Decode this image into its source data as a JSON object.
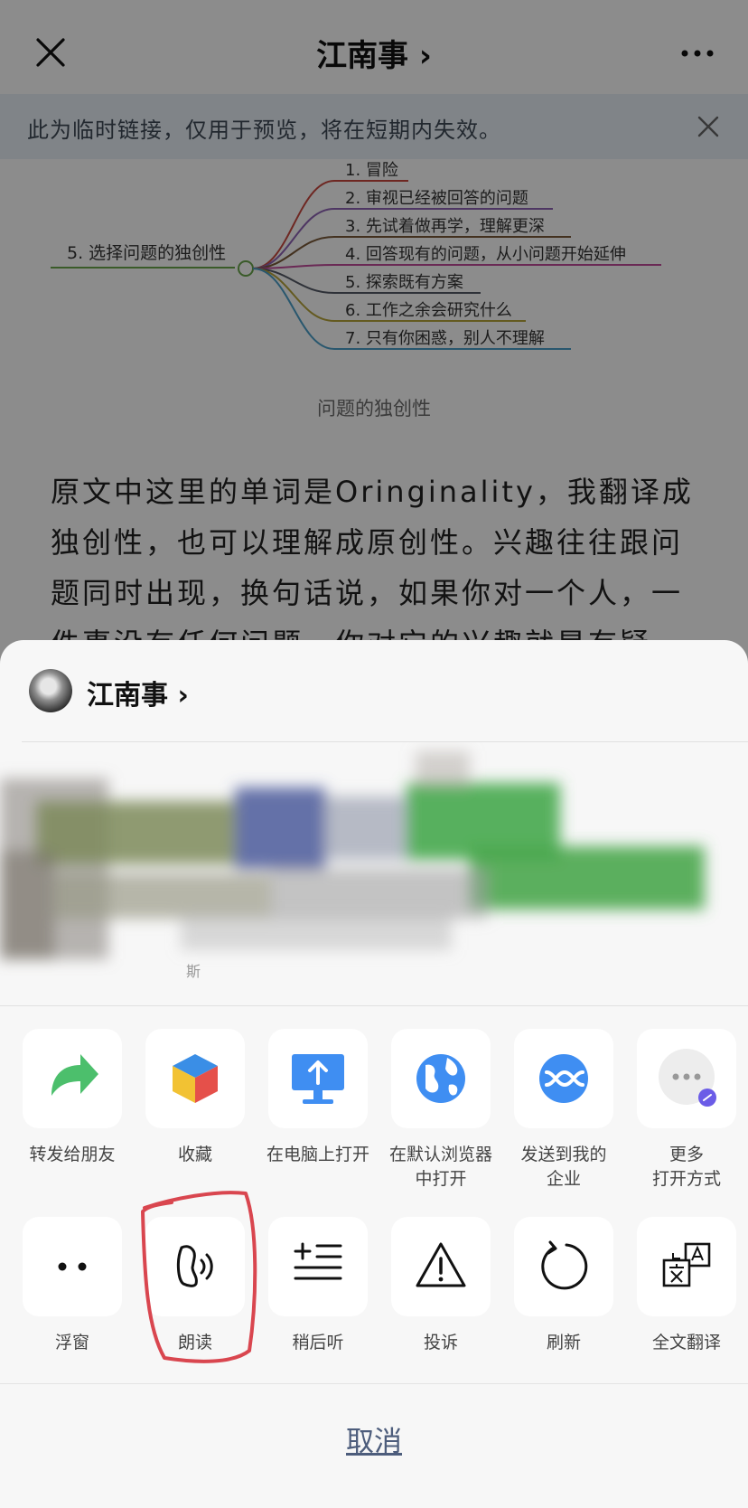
{
  "header": {
    "title": "江南事 ›",
    "close_icon": "close-icon",
    "more_icon": "more-dots-icon"
  },
  "notice": {
    "text": "此为临时链接，仅用于预览，将在短期内失效。"
  },
  "mindmap": {
    "root": "5. 选择问题的独创性",
    "branches": [
      "1. 冒险",
      "2. 审视已经被回答的问题",
      "3. 先试着做再学，理解更深",
      "4. 回答现有的问题，从小问题开始延伸",
      "5. 探索既有方案",
      "6. 工作之余会研究什么",
      "7. 只有你困惑，别人不理解"
    ],
    "branch_colors": [
      "#c8473e",
      "#8e63b5",
      "#7a5a3a",
      "#c24b9b",
      "#555a66",
      "#b7a43b",
      "#4b9fc9"
    ],
    "caption": "问题的独创性"
  },
  "article": {
    "paragraph": "原文中这里的单词是Oringinality，我翻译成独创性，也可以理解成原创性。兴趣往往跟问题同时出现，换句话说，如果你对一个人，一件事没有任何问题，你对它的兴趣就是有疑"
  },
  "sheet": {
    "account_name": "江南事 ›",
    "preview_small_text": "斯",
    "actions_row1": [
      {
        "label": "转发给朋友",
        "icon": "share-arrow-icon"
      },
      {
        "label": "收藏",
        "icon": "favorite-cube-icon"
      },
      {
        "label": "在电脑上打开",
        "icon": "computer-upload-icon"
      },
      {
        "label": "在默认浏览器\n中打开",
        "icon": "globe-icon"
      },
      {
        "label": "发送到我的\n企业",
        "icon": "enterprise-wechat-icon"
      },
      {
        "label": "更多\n打开方式",
        "icon": "more-open-icon"
      }
    ],
    "actions_row2": [
      {
        "label": "浮窗",
        "icon": "float-window-icon"
      },
      {
        "label": "朗读",
        "icon": "read-aloud-icon"
      },
      {
        "label": "稍后听",
        "icon": "listen-later-icon"
      },
      {
        "label": "投诉",
        "icon": "warning-icon"
      },
      {
        "label": "刷新",
        "icon": "refresh-icon"
      },
      {
        "label": "全文翻译",
        "icon": "translate-icon"
      }
    ],
    "cancel": "取消"
  },
  "colors": {
    "accent_blue": "#3f8ef2",
    "share_green": "#4cbf6c",
    "highlight_red": "#d9464f"
  }
}
